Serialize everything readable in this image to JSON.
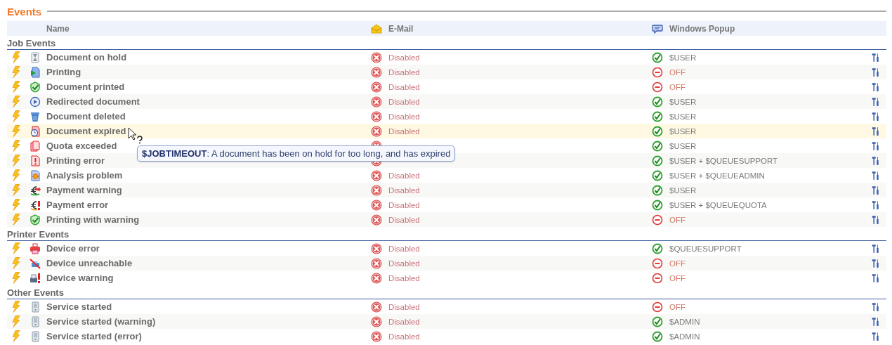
{
  "title": "Events",
  "columns": {
    "name": "Name",
    "email": "E-Mail",
    "popup": "Windows Popup"
  },
  "groups": [
    {
      "label": "Job Events",
      "events": [
        {
          "name": "Document on hold",
          "kind": "hourglass",
          "hovered": false,
          "email": {
            "enabled": false,
            "text": "Disabled"
          },
          "popup": {
            "enabled": true,
            "text": "$USER"
          }
        },
        {
          "name": "Printing",
          "kind": "play",
          "hovered": false,
          "email": {
            "enabled": false,
            "text": "Disabled"
          },
          "popup": {
            "enabled": false,
            "text": "OFF"
          }
        },
        {
          "name": "Document printed",
          "kind": "check",
          "hovered": false,
          "email": {
            "enabled": false,
            "text": "Disabled"
          },
          "popup": {
            "enabled": false,
            "text": "OFF"
          }
        },
        {
          "name": "Redirected document",
          "kind": "redirect",
          "hovered": false,
          "email": {
            "enabled": false,
            "text": "Disabled"
          },
          "popup": {
            "enabled": true,
            "text": "$USER"
          }
        },
        {
          "name": "Document deleted",
          "kind": "trash",
          "hovered": false,
          "email": {
            "enabled": false,
            "text": "Disabled"
          },
          "popup": {
            "enabled": true,
            "text": "$USER"
          }
        },
        {
          "name": "Document expired",
          "kind": "clock",
          "hovered": true,
          "email": {
            "enabled": false,
            "text": "Disabled"
          },
          "popup": {
            "enabled": true,
            "text": "$USER"
          }
        },
        {
          "name": "Quota exceeded",
          "kind": "pages",
          "hovered": false,
          "email": {
            "enabled": false
          },
          "popup": {
            "enabled": true,
            "text": "$USER"
          }
        },
        {
          "name": "Printing error",
          "kind": "docerror",
          "hovered": false,
          "email": {
            "enabled": false
          },
          "popup": {
            "enabled": true,
            "text": "$USER + $QUEUESUPPORT"
          }
        },
        {
          "name": "Analysis problem",
          "kind": "gear",
          "hovered": false,
          "email": {
            "enabled": false,
            "text": "Disabled"
          },
          "popup": {
            "enabled": true,
            "text": "$USER + $QUEUEADMIN"
          }
        },
        {
          "name": "Payment warning",
          "kind": "euroarrow",
          "hovered": false,
          "email": {
            "enabled": false,
            "text": "Disabled"
          },
          "popup": {
            "enabled": true,
            "text": "$USER"
          }
        },
        {
          "name": "Payment error",
          "kind": "euroerror",
          "hovered": false,
          "email": {
            "enabled": false,
            "text": "Disabled"
          },
          "popup": {
            "enabled": true,
            "text": "$USER + $QUEUEQUOTA"
          }
        },
        {
          "name": "Printing with warning",
          "kind": "check",
          "hovered": false,
          "email": {
            "enabled": false,
            "text": "Disabled"
          },
          "popup": {
            "enabled": false,
            "text": "OFF"
          }
        }
      ]
    },
    {
      "label": "Printer Events",
      "events": [
        {
          "name": "Device error",
          "kind": "printer",
          "hovered": false,
          "email": {
            "enabled": false,
            "text": "Disabled"
          },
          "popup": {
            "enabled": true,
            "text": "$QUEUESUPPORT"
          }
        },
        {
          "name": "Device unreachable",
          "kind": "unreachable",
          "hovered": false,
          "email": {
            "enabled": false,
            "text": "Disabled"
          },
          "popup": {
            "enabled": false,
            "text": "OFF"
          }
        },
        {
          "name": "Device warning",
          "kind": "devwarn",
          "hovered": false,
          "email": {
            "enabled": false,
            "text": "Disabled"
          },
          "popup": {
            "enabled": false,
            "text": "OFF"
          }
        }
      ]
    },
    {
      "label": "Other Events",
      "events": [
        {
          "name": "Service started",
          "kind": "server",
          "hovered": false,
          "email": {
            "enabled": false,
            "text": "Disabled"
          },
          "popup": {
            "enabled": false,
            "text": "OFF"
          }
        },
        {
          "name": "Service started (warning)",
          "kind": "server",
          "hovered": false,
          "email": {
            "enabled": false,
            "text": "Disabled"
          },
          "popup": {
            "enabled": true,
            "text": "$ADMIN"
          }
        },
        {
          "name": "Service started (error)",
          "kind": "server",
          "hovered": false,
          "email": {
            "enabled": false,
            "text": "Disabled"
          },
          "popup": {
            "enabled": true,
            "text": "$ADMIN"
          }
        }
      ]
    }
  ],
  "tooltip": "**$JOBTIMEOUT**: A document has been on hold for too long, and has expired"
}
